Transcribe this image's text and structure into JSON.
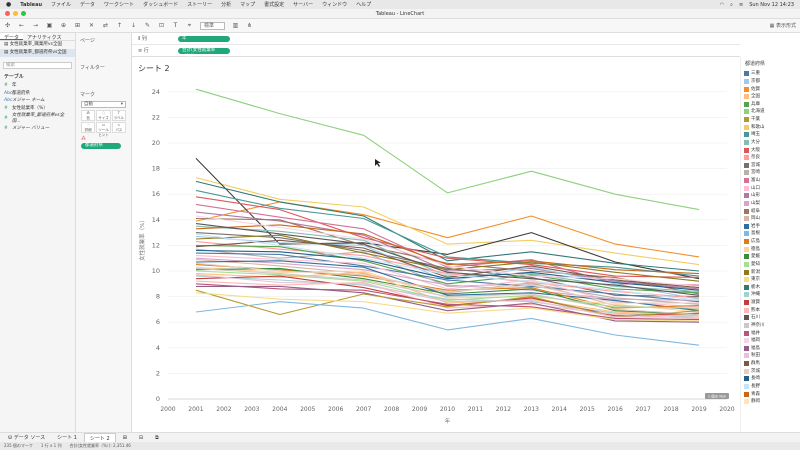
{
  "menubar": {
    "app": "Tableau",
    "items": [
      "ファイル",
      "データ",
      "ワークシート",
      "ダッシュボード",
      "ストーリー",
      "分析",
      "マップ",
      "書式設定",
      "サーバー",
      "ウィンドウ",
      "ヘルプ"
    ],
    "clock": "Sun Nov 12  14:23"
  },
  "window": {
    "title": "Tableau - LineChart"
  },
  "toolbar": {
    "mark_size_select": "標準",
    "present_label": "表示形式"
  },
  "left_pane": {
    "tabs": [
      "データ",
      "アナリティクス"
    ],
    "datasources": [
      "女性就業率_職業所vs全国",
      "女性就業率_都道府県vs全国"
    ],
    "search_placeholder": "検索",
    "table_section": "テーブル",
    "fields": [
      {
        "icon": "#",
        "name": "年",
        "italic": false,
        "dim": false
      },
      {
        "icon": "Abc",
        "name": "都道府県",
        "italic": false,
        "dim": true
      },
      {
        "icon": "Abc",
        "name": "メジャー ネーム",
        "italic": true,
        "dim": true
      },
      {
        "icon": "#",
        "name": "女性就業率（%）",
        "italic": false,
        "dim": false
      },
      {
        "icon": "#",
        "name": "女性就業率_都道府県vs全国...",
        "italic": true,
        "dim": false
      },
      {
        "icon": "#",
        "name": "メジャー バリュー",
        "italic": true,
        "dim": false
      }
    ]
  },
  "cards": {
    "pages": "ページ",
    "filters": "フィルター",
    "marks": "マーク",
    "mark_type": "自動",
    "mark_buttons": [
      "色",
      "サイズ",
      "ラベル",
      "詳細",
      "ツールヒント",
      "パス"
    ],
    "color_pill": "都道府県"
  },
  "shelves": {
    "columns_label": "列",
    "columns_pill": "年",
    "rows_label": "行",
    "rows_pill": "合計(女性就業率（%)）"
  },
  "sheet": {
    "title": "シート 2"
  },
  "legend": {
    "title": "都道府県",
    "items": [
      {
        "name": "三重",
        "color": "#4e79a7"
      },
      {
        "name": "京都",
        "color": "#a0cbe8"
      },
      {
        "name": "佐賀",
        "color": "#f28e2b"
      },
      {
        "name": "全国",
        "color": "#ffbe7d"
      },
      {
        "name": "兵庫",
        "color": "#59a14f"
      },
      {
        "name": "北海道",
        "color": "#8cd17d"
      },
      {
        "name": "千葉",
        "color": "#b6992d"
      },
      {
        "name": "和歌山",
        "color": "#f1ce63"
      },
      {
        "name": "埼玉",
        "color": "#499894"
      },
      {
        "name": "大分",
        "color": "#86bcb6"
      },
      {
        "name": "大阪",
        "color": "#e15759"
      },
      {
        "name": "奈良",
        "color": "#ff9d9a"
      },
      {
        "name": "宮城",
        "color": "#79706e"
      },
      {
        "name": "宮崎",
        "color": "#bab0ac"
      },
      {
        "name": "富山",
        "color": "#d37295"
      },
      {
        "name": "山口",
        "color": "#fabfd2"
      },
      {
        "name": "山形",
        "color": "#b07aa1"
      },
      {
        "name": "山梨",
        "color": "#d4a6c8"
      },
      {
        "name": "岐阜",
        "color": "#9d7660"
      },
      {
        "name": "岡山",
        "color": "#d7b5a6"
      },
      {
        "name": "岩手",
        "color": "#2f6f9f"
      },
      {
        "name": "島根",
        "color": "#7fb8e0"
      },
      {
        "name": "広島",
        "color": "#e07b1a"
      },
      {
        "name": "徳島",
        "color": "#ffd29a"
      },
      {
        "name": "愛媛",
        "color": "#3d8c3a"
      },
      {
        "name": "愛知",
        "color": "#a6dd98"
      },
      {
        "name": "新潟",
        "color": "#8f7a1f"
      },
      {
        "name": "東京",
        "color": "#f5dc8a"
      },
      {
        "name": "栃木",
        "color": "#317a76"
      },
      {
        "name": "沖縄",
        "color": "#a3d2cd"
      },
      {
        "name": "滋賀",
        "color": "#c33c3e"
      },
      {
        "name": "熊本",
        "color": "#ffb8b5"
      },
      {
        "name": "石川",
        "color": "#5e5654"
      },
      {
        "name": "神奈川",
        "color": "#cfc7c4"
      },
      {
        "name": "福井",
        "color": "#b85579"
      },
      {
        "name": "福岡",
        "color": "#f7d4e2"
      },
      {
        "name": "福島",
        "color": "#945e88"
      },
      {
        "name": "秋田",
        "color": "#e5c2dc"
      },
      {
        "name": "群馬",
        "color": "#7d5a47"
      },
      {
        "name": "茨城",
        "color": "#e5cdc2"
      },
      {
        "name": "長崎",
        "color": "#1f5f8b"
      },
      {
        "name": "長野",
        "color": "#c9e3f5"
      },
      {
        "name": "青森",
        "color": "#c9661a"
      },
      {
        "name": "静岡",
        "color": "#ffe3bd"
      }
    ]
  },
  "bottom": {
    "datasource_tab": "データ ソース",
    "sheets": [
      "シート 1",
      "シート 2"
    ]
  },
  "status": {
    "marks": "235 個のマーク",
    "layout": "1 行 x 1 列",
    "sum": "合計(女性就業率（%）): 2,351.46"
  },
  "chart_data": {
    "type": "line",
    "ylabel": "女性就業率（%）",
    "xlabel": "年",
    "x_ticks": [
      2000,
      2001,
      2002,
      2003,
      2004,
      2005,
      2006,
      2007,
      2008,
      2009,
      2010,
      2011,
      2012,
      2013,
      2014,
      2015,
      2016,
      2017,
      2018,
      2019,
      2020
    ],
    "y_ticks": [
      0,
      2,
      4,
      6,
      8,
      10,
      12,
      14,
      16,
      18,
      20,
      22,
      24
    ],
    "xlim": [
      2000,
      2020
    ],
    "ylim": [
      0,
      25
    ],
    "null_badge": "1 個の Null",
    "x": [
      2001,
      2004,
      2007,
      2010,
      2013,
      2016,
      2019
    ],
    "series": [
      {
        "values": [
          24.2,
          22.3,
          20.6,
          16.1,
          17.8,
          16.0,
          14.8
        ],
        "color": "#8cd17d"
      },
      {
        "values": [
          13.9,
          15.4,
          14.4,
          12.6,
          14.3,
          12.1,
          11.1
        ],
        "color": "#f28e2b"
      },
      {
        "values": [
          17.3,
          15.6,
          15.0,
          12.1,
          12.4,
          11.4,
          10.5
        ],
        "color": "#f1ce63"
      },
      {
        "values": [
          18.8,
          12.1,
          12.2,
          11.3,
          13.0,
          10.7,
          9.4
        ],
        "color": "#3d3d3d"
      },
      {
        "values": [
          17.0,
          15.4,
          14.3,
          10.8,
          11.5,
          10.6,
          10.0
        ],
        "color": "#317a76"
      },
      {
        "values": [
          16.3,
          14.9,
          14.1,
          11.1,
          10.6,
          10.3,
          9.6
        ],
        "color": "#499894"
      },
      {
        "values": [
          15.8,
          14.8,
          12.6,
          11.0,
          10.5,
          9.6,
          9.5
        ],
        "color": "#e15759"
      },
      {
        "values": [
          15.2,
          14.2,
          13.3,
          10.3,
          10.9,
          9.0,
          8.9
        ],
        "color": "#d37295"
      },
      {
        "values": [
          14.6,
          13.9,
          12.8,
          10.0,
          10.2,
          9.2,
          8.6
        ],
        "color": "#b07aa1"
      },
      {
        "values": [
          14.1,
          14.0,
          12.0,
          10.6,
          10.0,
          9.5,
          8.2
        ],
        "color": "#9d7660"
      },
      {
        "values": [
          13.5,
          13.1,
          12.4,
          9.6,
          9.8,
          8.8,
          8.4
        ],
        "color": "#86bcb6"
      },
      {
        "values": [
          13.0,
          12.6,
          11.6,
          10.2,
          9.5,
          8.1,
          8.0
        ],
        "color": "#79706e"
      },
      {
        "values": [
          12.7,
          12.2,
          12.0,
          9.2,
          10.3,
          9.0,
          7.8
        ],
        "color": "#a0cbe8"
      },
      {
        "values": [
          12.3,
          11.7,
          11.2,
          9.8,
          9.1,
          8.4,
          7.9
        ],
        "color": "#ff9d9a"
      },
      {
        "values": [
          12.0,
          11.9,
          10.8,
          9.0,
          9.7,
          8.6,
          8.3
        ],
        "color": "#59a14f"
      },
      {
        "values": [
          11.7,
          11.0,
          11.5,
          8.8,
          9.0,
          7.9,
          7.4
        ],
        "color": "#bab0ac"
      },
      {
        "values": [
          11.4,
          11.3,
          10.4,
          9.3,
          8.8,
          8.2,
          7.6
        ],
        "color": "#4e79a7"
      },
      {
        "values": [
          11.2,
          10.9,
          10.6,
          8.6,
          9.3,
          7.6,
          7.2
        ],
        "color": "#fabfd2"
      },
      {
        "values": [
          11.0,
          10.6,
          10.1,
          8.9,
          8.5,
          7.8,
          7.7
        ],
        "color": "#d4a6c8"
      },
      {
        "values": [
          10.9,
          10.4,
          9.8,
          8.3,
          9.1,
          7.3,
          7.0
        ],
        "color": "#d7b5a6"
      },
      {
        "values": [
          10.7,
          10.8,
          10.3,
          8.1,
          8.3,
          7.7,
          6.9
        ],
        "color": "#2f6f9f"
      },
      {
        "values": [
          10.5,
          10.1,
          9.6,
          8.5,
          8.7,
          7.1,
          7.3
        ],
        "color": "#e07b1a"
      },
      {
        "values": [
          10.3,
          9.9,
          10.0,
          7.9,
          8.0,
          7.4,
          6.8
        ],
        "color": "#ffd29a"
      },
      {
        "values": [
          10.1,
          10.2,
          9.4,
          8.2,
          8.6,
          6.9,
          6.6
        ],
        "color": "#3d8c3a"
      },
      {
        "values": [
          10.0,
          9.7,
          9.2,
          7.7,
          8.1,
          7.2,
          7.1
        ],
        "color": "#a6dd98"
      },
      {
        "values": [
          9.8,
          9.5,
          9.9,
          7.5,
          7.8,
          6.8,
          6.5
        ],
        "color": "#ffbe7d"
      },
      {
        "values": [
          9.6,
          9.3,
          8.9,
          7.8,
          7.6,
          6.7,
          6.4
        ],
        "color": "#a3d2cd"
      },
      {
        "values": [
          9.4,
          9.6,
          8.7,
          7.3,
          7.9,
          6.5,
          6.7
        ],
        "color": "#c33c3e"
      },
      {
        "values": [
          9.2,
          8.9,
          9.1,
          7.1,
          7.4,
          6.6,
          6.3
        ],
        "color": "#ffb8b5"
      },
      {
        "values": [
          9.0,
          8.6,
          8.5,
          7.4,
          7.2,
          6.3,
          6.2
        ],
        "color": "#b85579"
      },
      {
        "values": [
          8.8,
          8.8,
          8.3,
          6.9,
          7.5,
          6.1,
          6.0
        ],
        "color": "#945e88"
      },
      {
        "values": [
          8.5,
          6.6,
          8.2,
          7.2,
          8.0,
          6.4,
          6.9
        ],
        "color": "#b6992d"
      },
      {
        "values": [
          8.3,
          7.8,
          7.6,
          6.7,
          7.1,
          6.2,
          6.1
        ],
        "color": "#f5dc8a"
      },
      {
        "values": [
          6.8,
          7.6,
          7.1,
          5.4,
          6.3,
          5.0,
          4.2
        ],
        "color": "#7fb8e0"
      },
      {
        "values": [
          12.5,
          12.8,
          11.4,
          10.1,
          10.7,
          9.9,
          9.2
        ],
        "color": "#8f7a1f"
      },
      {
        "values": [
          11.9,
          12.4,
          11.8,
          9.5,
          10.4,
          9.3,
          8.7
        ],
        "color": "#7d5a47"
      },
      {
        "values": [
          11.6,
          11.5,
          10.9,
          9.4,
          9.9,
          9.1,
          8.5
        ],
        "color": "#1f5f8b"
      },
      {
        "values": [
          13.3,
          13.6,
          12.9,
          10.5,
          10.8,
          10.1,
          9.8
        ],
        "color": "#c9661a"
      },
      {
        "values": [
          10.6,
          10.0,
          9.7,
          8.4,
          8.9,
          7.5,
          7.5
        ],
        "color": "#e5cdc2"
      },
      {
        "values": [
          10.2,
          9.8,
          9.3,
          8.0,
          8.2,
          7.0,
          6.6
        ],
        "color": "#cfc7c4"
      },
      {
        "values": [
          9.7,
          9.1,
          9.0,
          7.6,
          7.7,
          6.4,
          6.4
        ],
        "color": "#e5c2dc"
      },
      {
        "values": [
          14.3,
          13.4,
          12.5,
          10.4,
          9.6,
          9.4,
          8.8
        ],
        "color": "#f7d4e2"
      },
      {
        "values": [
          13.7,
          12.9,
          12.1,
          9.9,
          9.4,
          8.9,
          8.1
        ],
        "color": "#5e5654"
      },
      {
        "values": [
          12.9,
          12.0,
          11.0,
          9.7,
          9.2,
          8.5,
          7.7
        ],
        "color": "#c9e3f5"
      }
    ]
  }
}
